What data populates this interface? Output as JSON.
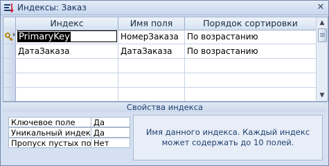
{
  "window": {
    "title": "Индексы: Заказ",
    "close_glyph": "✕"
  },
  "grid": {
    "columns": [
      "Индекс",
      "Имя поля",
      "Порядок сортировки"
    ],
    "rows": [
      {
        "index": "PrimaryKey",
        "field": "НомерЗаказа",
        "sort": "По возрастанию",
        "key_icon": "key-icon"
      },
      {
        "index": "ДатаЗаказа",
        "field": "ДатаЗаказа",
        "sort": "По возрастанию"
      }
    ]
  },
  "properties": {
    "caption": "Свойства индекса",
    "items": [
      {
        "label": "Ключевое поле",
        "value": "Да"
      },
      {
        "label": "Уникальный индекс",
        "value": "Да"
      },
      {
        "label": "Пропуск пустых поле",
        "value": "Нет"
      }
    ],
    "help": "Имя данного индекса.  Каждый индекс может содержать до 10 полей."
  },
  "colors": {
    "accent": "#15315a",
    "selection": "#000000"
  }
}
